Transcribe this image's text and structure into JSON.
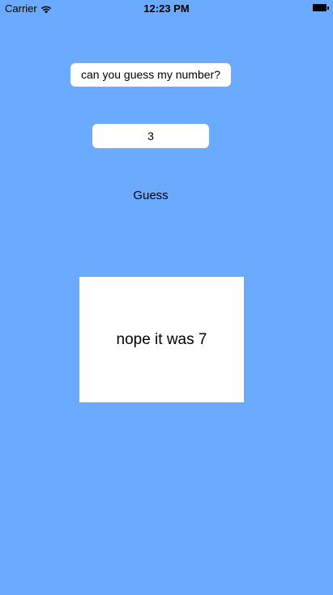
{
  "status_bar": {
    "carrier": "Carrier",
    "time": "12:23 PM",
    "wifi_icon": "wifi-icon",
    "battery_icon": "battery-icon"
  },
  "prompt": {
    "text": "can you guess my number?"
  },
  "guess_field": {
    "value": "3",
    "placeholder": ""
  },
  "guess_button": {
    "label": "Guess"
  },
  "result": {
    "text": "nope it was 7"
  },
  "colors": {
    "background": "#6aabff",
    "card": "#ffffff",
    "text": "#000000"
  }
}
